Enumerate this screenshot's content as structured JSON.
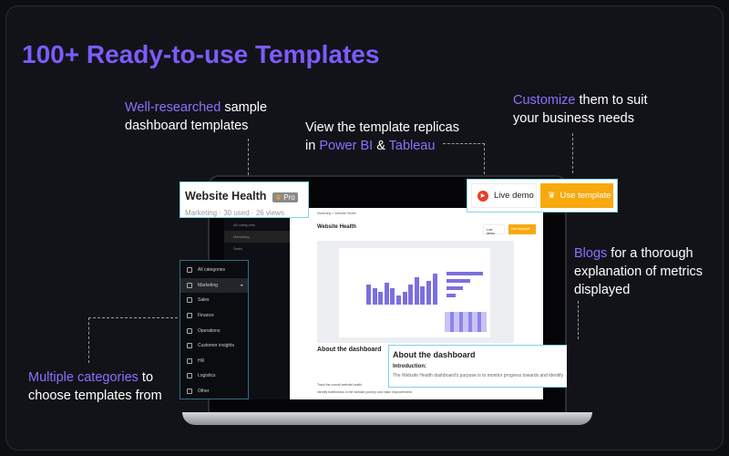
{
  "title": "100+ Ready-to-use Templates",
  "notes": {
    "researched": {
      "hl": "Well-researched",
      "rest": " sample",
      "line2": "dashboard templates"
    },
    "replicas": {
      "line1": "View the template replicas",
      "pre": "in ",
      "bi": "Power BI",
      "amp": " & ",
      "tableau": "Tableau"
    },
    "customize": {
      "hl": "Customize",
      "rest": " them to suit",
      "line2": "your business needs"
    },
    "blogs": {
      "hl": "Blogs",
      "rest": " for a thorough",
      "line2": "explanation of metrics",
      "line3": "displayed"
    },
    "categories": {
      "hl": "Multiple categories",
      "rest": " to",
      "line2": "choose templates from"
    }
  },
  "template_card": {
    "name": "Website Health",
    "badge": "Pro",
    "meta": "Marketing · 30 used · 26 views"
  },
  "actions": {
    "live_demo": "Live demo",
    "use_template": "Use template"
  },
  "categories": [
    "All categories",
    "Marketing",
    "Sales",
    "Finance",
    "Operations",
    "Customer insights",
    "HR",
    "Logistics",
    "Other"
  ],
  "about": {
    "heading": "About the dashboard",
    "subheading": "Introduction:",
    "text": "The Website Health dashboard's purpose is to monitor progress towards and identify opportunities to accomplish key goals, including:"
  },
  "screen": {
    "breadcrumb": "Marketing > Website Health",
    "bullets": [
      "Track the overall website health",
      "Identify bottlenecks in the website journey and make improvements"
    ]
  },
  "chart_bars": [
    0.55,
    0.45,
    0.35,
    0.6,
    0.45,
    0.25,
    0.35,
    0.55,
    0.75,
    0.5,
    0.65,
    0.85
  ]
}
